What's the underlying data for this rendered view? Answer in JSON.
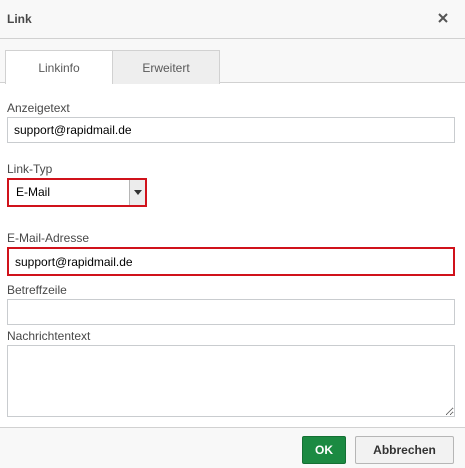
{
  "dialog": {
    "title": "Link",
    "close_icon": "close-icon"
  },
  "tabs": [
    {
      "label": "Linkinfo",
      "active": true
    },
    {
      "label": "Erweitert",
      "active": false
    }
  ],
  "form": {
    "display_text": {
      "label": "Anzeigetext",
      "value": "support@rapidmail.de"
    },
    "link_type": {
      "label": "Link-Typ",
      "value": "E-Mail"
    },
    "email_address": {
      "label": "E-Mail-Adresse",
      "value": "support@rapidmail.de"
    },
    "subject": {
      "label": "Betreffzeile",
      "value": ""
    },
    "message_body": {
      "label": "Nachrichtentext",
      "value": ""
    }
  },
  "buttons": {
    "ok_label": "OK",
    "cancel_label": "Abbrechen"
  },
  "colors": {
    "ok_button": "#1b8a42",
    "highlight": "#d0121b"
  }
}
